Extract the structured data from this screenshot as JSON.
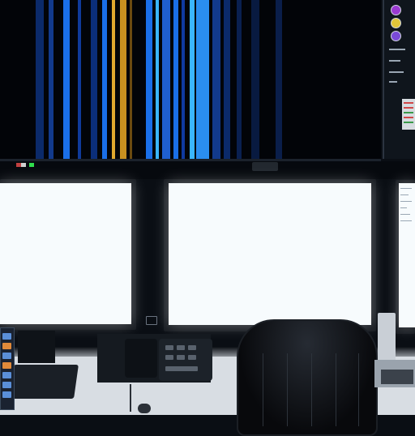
{
  "scene": {
    "description_tag": "",
    "colors": {
      "stripe_blue": "#1a6fe8",
      "stripe_cyan": "#3ab6ff",
      "stripe_gold": "#e0a82e",
      "screen_white": "#f7fbfd",
      "led_green": "#2fdc4c",
      "desk": "#d8dde3"
    }
  },
  "icons": {
    "side_panel": [
      "purple-dot-icon",
      "yellow-dot-icon",
      "violet-dot-icon"
    ],
    "center_monitor_logo": "monitor-logo-icon",
    "status_leds": [
      "red-led-icon",
      "white-led-icon",
      "green-led-icon"
    ]
  }
}
